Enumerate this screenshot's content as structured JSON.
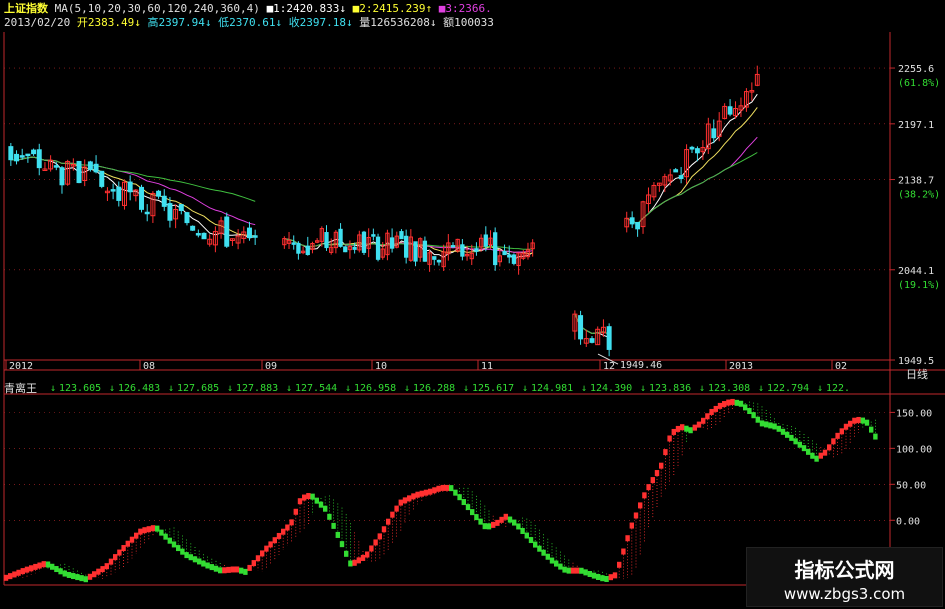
{
  "header": {
    "index_name": "上证指数",
    "ma_params": "MA(5,10,20,30,60,120,240,360,4)",
    "ma1": "■1:2420.833↓",
    "ma2": "■2:2415.239↑",
    "ma3": "■3:2366.",
    "date": "2013/02/20",
    "open": "开2383.49↓",
    "high": "高2397.94↓",
    "low": "低2370.61↓",
    "close": "收2397.18↓",
    "volume": "量126536208↓",
    "amount": "额100033"
  },
  "colors": {
    "up": "#ff3030",
    "down": "#40e0f0",
    "frame": "#c0282d",
    "axis_text": "#e0e0e0",
    "green": "#33dd33",
    "ma_yellow": "#f0e060",
    "ma_magenta": "#e040e0",
    "ma_green": "#40c040",
    "ma_white": "#ffffff"
  },
  "chart_data": [
    {
      "type": "candlestick",
      "title": "上证指数",
      "y_ticks": [
        "2255.6",
        "(61.8%)",
        "2197.1",
        "2138.7",
        "(38.2%)",
        "2044.1",
        "(19.1%)",
        "1949.5"
      ],
      "y_tick_values": [
        2255.6,
        2241,
        2197.1,
        2138.7,
        2124,
        2044.1,
        2029,
        1949.5
      ],
      "ylim": [
        1949.5,
        2285
      ],
      "x_ticks": [
        "2012",
        "08",
        "09",
        "10",
        "11",
        "12",
        "2013",
        "02"
      ],
      "period_label": "日线",
      "annotation": "1949.46",
      "annotation_value": 1949.46,
      "segments": [
        {
          "start_close": 2168,
          "end_close": 2070,
          "n": 44,
          "seed": 3
        },
        {
          "start_close": 2075,
          "end_close": 2060,
          "n": 54,
          "seed": 7
        },
        {
          "start_close": 2095,
          "end_close": 2085,
          "n": 45,
          "seed": 11
        },
        {
          "start_close": 1985,
          "end_close": 1970,
          "n": 7,
          "seed": 17
        },
        {
          "start_close": 2085,
          "end_close": 2245,
          "n": 25,
          "seed": 23
        }
      ]
    },
    {
      "type": "line",
      "title": "青离王",
      "values_row": [
        "123.605",
        "126.483",
        "127.685",
        "127.883",
        "127.544",
        "126.958",
        "126.288",
        "125.617",
        "124.981",
        "124.390",
        "123.836",
        "123.308",
        "122.794",
        "122."
      ],
      "y_ticks": [
        "150.00",
        "100.00",
        "50.00",
        "0.00"
      ],
      "y_tick_values": [
        150,
        100,
        50,
        0
      ],
      "ylim": [
        -90,
        170
      ],
      "keypoints": [
        [
          0,
          -80
        ],
        [
          18,
          -70
        ],
        [
          40,
          -60
        ],
        [
          60,
          -75
        ],
        [
          80,
          -82
        ],
        [
          100,
          -65
        ],
        [
          120,
          -35
        ],
        [
          135,
          -15
        ],
        [
          150,
          -10
        ],
        [
          165,
          -30
        ],
        [
          180,
          -48
        ],
        [
          200,
          -62
        ],
        [
          215,
          -70
        ],
        [
          230,
          -68
        ],
        [
          240,
          -72
        ],
        [
          260,
          -40
        ],
        [
          285,
          -5
        ],
        [
          295,
          30
        ],
        [
          305,
          35
        ],
        [
          320,
          15
        ],
        [
          335,
          -30
        ],
        [
          345,
          -62
        ],
        [
          360,
          -50
        ],
        [
          375,
          -20
        ],
        [
          385,
          5
        ],
        [
          395,
          25
        ],
        [
          410,
          35
        ],
        [
          425,
          40
        ],
        [
          435,
          45
        ],
        [
          445,
          45
        ],
        [
          455,
          30
        ],
        [
          470,
          5
        ],
        [
          480,
          -10
        ],
        [
          490,
          -5
        ],
        [
          500,
          5
        ],
        [
          510,
          -5
        ],
        [
          520,
          -20
        ],
        [
          530,
          -35
        ],
        [
          545,
          -55
        ],
        [
          560,
          -70
        ],
        [
          575,
          -70
        ],
        [
          590,
          -78
        ],
        [
          600,
          -82
        ],
        [
          610,
          -76
        ],
        [
          625,
          -10
        ],
        [
          640,
          40
        ],
        [
          655,
          75
        ],
        [
          665,
          120
        ],
        [
          675,
          130
        ],
        [
          685,
          125
        ],
        [
          695,
          135
        ],
        [
          705,
          150
        ],
        [
          715,
          160
        ],
        [
          725,
          165
        ],
        [
          735,
          162
        ],
        [
          745,
          150
        ],
        [
          755,
          135
        ],
        [
          770,
          130
        ],
        [
          785,
          115
        ],
        [
          800,
          98
        ],
        [
          810,
          85
        ],
        [
          820,
          95
        ],
        [
          830,
          115
        ],
        [
          840,
          130
        ],
        [
          850,
          140
        ],
        [
          860,
          138
        ],
        [
          870,
          115
        ]
      ]
    }
  ],
  "watermark": {
    "line1": "指标公式网",
    "line2": "www.zbgs3.com"
  }
}
